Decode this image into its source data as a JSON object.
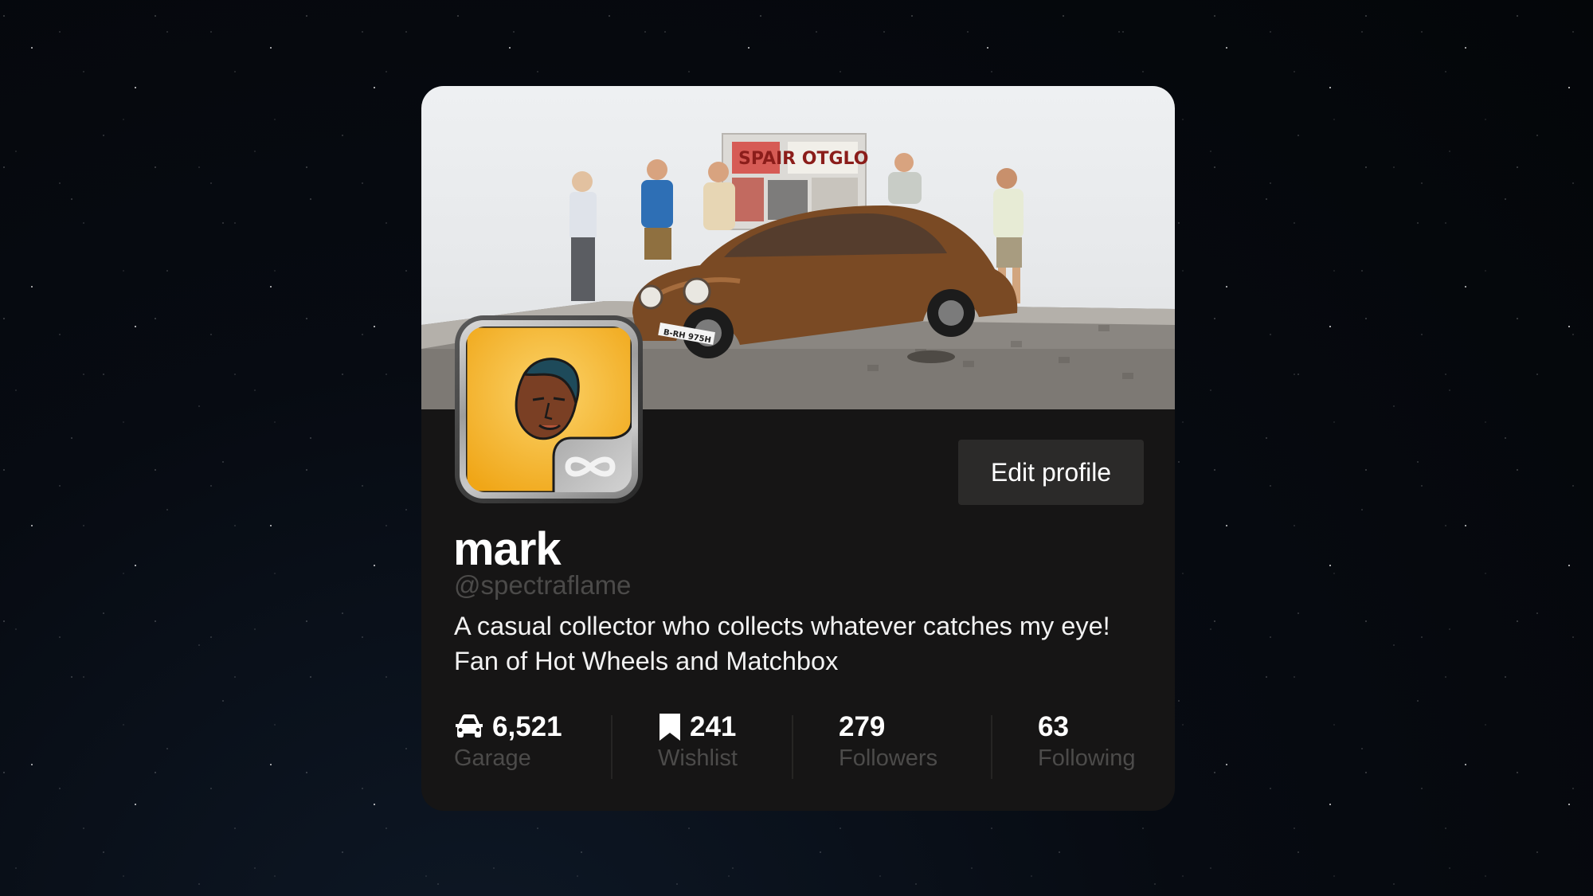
{
  "profile": {
    "name": "mark",
    "handle": "@spectraflame",
    "bio": "A casual collector who collects whatever catches my eye! Fan of Hot Wheels and Matchbox",
    "edit_label": "Edit profile",
    "banner_sign_text": "SPAIR OTGLO",
    "plate_text": "B-RH 975H"
  },
  "stats": [
    {
      "value": "6,521",
      "label": "Garage",
      "icon": "car-icon"
    },
    {
      "value": "241",
      "label": "Wishlist",
      "icon": "bookmark-icon"
    },
    {
      "value": "279",
      "label": "Followers",
      "icon": ""
    },
    {
      "value": "63",
      "label": "Following",
      "icon": ""
    }
  ],
  "colors": {
    "background": "#05080d",
    "card": "#161515",
    "button": "#2b2a29",
    "muted_text": "#4c4b4a",
    "avatar_yellow": "#f5b21f"
  }
}
